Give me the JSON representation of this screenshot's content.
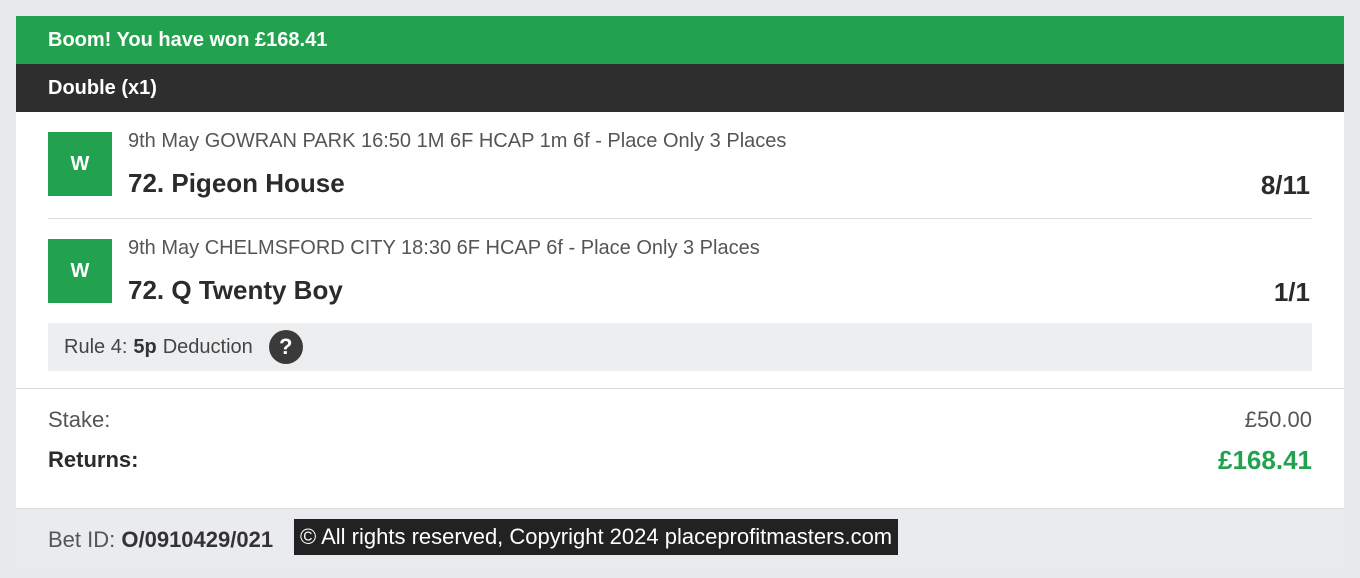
{
  "banner": {
    "text": "Boom! You have won £168.41"
  },
  "bet": {
    "type": "Double (x1)"
  },
  "legs": [
    {
      "status": "W",
      "description": "9th May GOWRAN PARK 16:50 1M 6F HCAP 1m 6f - Place Only 3 Places",
      "selection": "72. Pigeon House",
      "odds": "8/11"
    },
    {
      "status": "W",
      "description": "9th May CHELMSFORD CITY 18:30 6F HCAP 6f - Place Only 3 Places",
      "selection": "72. Q Twenty Boy",
      "odds": "1/1"
    }
  ],
  "rule4": {
    "prefix": "Rule 4:",
    "amount": "5p",
    "suffix": "Deduction",
    "help_glyph": "?"
  },
  "totals": {
    "stake_label": "Stake:",
    "stake_value": "£50.00",
    "returns_label": "Returns:",
    "returns_value": "£168.41"
  },
  "footer": {
    "bet_id_label": "Bet ID:",
    "bet_id_value": "O/0910429/021",
    "copyright": "© All rights reserved, Copyright 2024 placeprofitmasters.com"
  },
  "colors": {
    "accent": "#22a24f",
    "header_dark": "#2e2e2e"
  },
  "icons": {
    "help": "help-icon"
  }
}
